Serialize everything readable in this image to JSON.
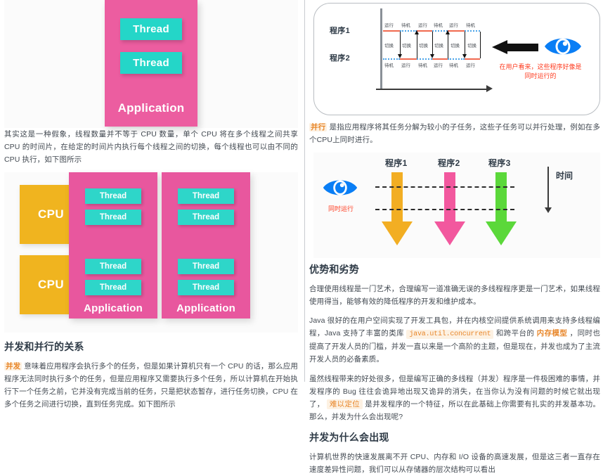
{
  "left": {
    "figure_app_single": {
      "app_label": "Application",
      "threads": [
        "Thread",
        "Thread"
      ],
      "colors": {
        "app": "#ec5da0",
        "thread": "#24d6c8",
        "text": "#ffffff"
      }
    },
    "paragraph_1": "其实这是一种假象，线程数量并不等于 CPU 数量，单个 CPU 将在多个线程之间共享 CPU 的时间片，在给定的时间片内执行每个线程之间的切换，每个线程也可以由不同的 CPU 执行，如下图所示",
    "figure_cpu": {
      "cpu_labels": [
        "CPU",
        "CPU"
      ],
      "applications": [
        {
          "label": "Application",
          "threads": [
            "Thread",
            "Thread",
            "Thread",
            "Thread"
          ]
        },
        {
          "label": "Application",
          "threads": [
            "Thread",
            "Thread",
            "Thread",
            "Thread"
          ]
        }
      ],
      "colors": {
        "cpu": "#f0b41f",
        "app": "#e8579e",
        "thread": "#2ed6c9"
      }
    },
    "heading_1": "并发和并行的关系",
    "paragraph_2_tag": "并发",
    "paragraph_2": "意味着应用程序会执行多个的任务，但是如果计算机只有一个 CPU 的话，那么应用程序无法同时执行多个的任务，但是应用程序又需要执行多个任务，所以计算机在开始执行下一个任务之前，它并没有完成当前的任务，只是把状态暂存，进行任务切换，CPU 在多个任务之间进行切换，直到任务完成。如下图所示"
  },
  "right": {
    "figure_timeline": {
      "program_labels": [
        "程序1",
        "程序2"
      ],
      "top_states": [
        "运行",
        "待机",
        "运行",
        "待机",
        "运行",
        "待机"
      ],
      "bottom_states": [
        "待机",
        "运行",
        "待机",
        "运行",
        "待机",
        "运行"
      ],
      "switch_labels": [
        "切换",
        "切换",
        "切换",
        "切换",
        "切换",
        "切换"
      ],
      "eye_caption_line1": "在用户看来，这些程序好像是",
      "eye_caption_line2": "同时运行的",
      "colors": {
        "run": "#f0694f",
        "idle": "#4aa3e8",
        "caption": "#fe3b1f",
        "eye": "#0a7ef5"
      }
    },
    "paragraph_1_tag": "并行",
    "paragraph_1": "是指应用程序将其任务分解为较小的子任务，这些子任务可以并行处理，例如在多个CPU上同时进行。",
    "figure_parallel": {
      "eye_caption": "同时运行",
      "program_labels": [
        "程序1",
        "程序2",
        "程序3"
      ],
      "time_label": "时间",
      "arrow_colors": [
        "#f2ae23",
        "#f2589e",
        "#5bd83a"
      ],
      "eye_color": "#0a7ef5",
      "caption_color": "#fe3b1f"
    },
    "heading_1": "优势和劣势",
    "paragraph_2": "合理使用线程是一门艺术，合理编写一道准确无误的多线程程序更是一门艺术，如果线程使用得当，能够有效的降低程序的开发和维护成本。",
    "paragraph_3_a": "Java 很好的在用户空间实现了开发工具包，并在内核空间提供系统调用来支持多线程编程，Java 支持了丰富的类库",
    "paragraph_3_code": "java.util.concurrent",
    "paragraph_3_b": "和跨平台的",
    "paragraph_3_tag": "内存模型",
    "paragraph_3_c": "，同时也提高了开发人员的门槛，并发一直以来是一个高阶的主题，但是现在，并发也成为了主流开发人员的必备素质。",
    "paragraph_4_a": "虽然线程带来的好处很多，但是编写正确的多线程（并发）程序是一件极困难的事情，并发程序的 Bug 往往会诡异地出现又诡异的消失，在当你认为没有问题的时候它就出现了，",
    "paragraph_4_tag": "难以定位",
    "paragraph_4_b": "是并发程序的一个特征，所以在此基础上你需要有扎实的并发基本功。那么，并发为什么会出现呢?",
    "heading_2": "并发为什么会出现",
    "paragraph_5": "计算机世界的快速发展离不开 CPU、内存和 I/O 设备的高速发展，但是这三者一直存在速度差异性问题，我们可以从存储器的层次结构可以看出"
  }
}
